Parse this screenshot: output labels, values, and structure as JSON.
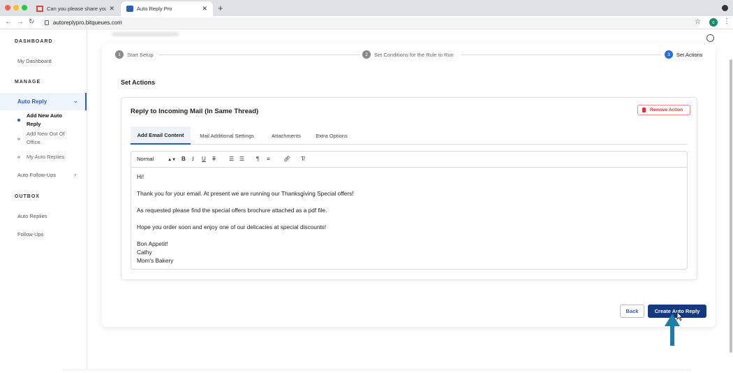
{
  "browser": {
    "tabs": [
      {
        "title": "Can you please share your me",
        "active": false
      },
      {
        "title": "Auto Reply Pro",
        "active": true
      }
    ],
    "url": "autoreplypro.bitqueues.com",
    "profile_initial": "c"
  },
  "sidebar": {
    "dashboard_heading": "DASHBOARD",
    "my_dashboard": "My Dashboard",
    "manage_heading": "MANAGE",
    "auto_reply": "Auto Reply",
    "sub_items": [
      "Add New Auto Reply",
      "Add New Out Of Office",
      "My Auto Replies"
    ],
    "auto_followups": "Auto Follow-Ups",
    "outbox_heading": "OUTBOX",
    "outbox_items": [
      "Auto Replies",
      "Follow-Ups"
    ]
  },
  "stepper": {
    "steps": [
      {
        "num": "1",
        "label": "Start Setup"
      },
      {
        "num": "2",
        "label": "Set Conditions for the Rule to Run"
      },
      {
        "num": "3",
        "label": "Set Actions"
      }
    ]
  },
  "main": {
    "section_title": "Set Actions",
    "action_title": "Reply to Incoming Mail (In Same Thread)",
    "remove_action": "Remove Action",
    "tabs": [
      "Add Email Content",
      "Mail Additional Settings",
      "Attachments",
      "Extra Options"
    ],
    "toolbar": {
      "format": "Normal"
    },
    "email_body": [
      "Hi!",
      "Thank you for your email. At present we are running our Thanksgiving Special offers!",
      "As requested please find the special offers brochure attached as a pdf file.",
      "Hope you order soon and enjoy one of our delicacies at special discounts!",
      "Bon Appetit!",
      "Cathy",
      "Mom's Bakery"
    ],
    "back_button": "Back",
    "create_button": "Create Auto Reply"
  },
  "colors": {
    "accent": "#2b5fb4",
    "primary_button": "#15397e",
    "danger": "#d33333",
    "annotation_arrow": "#1f7ea6"
  }
}
